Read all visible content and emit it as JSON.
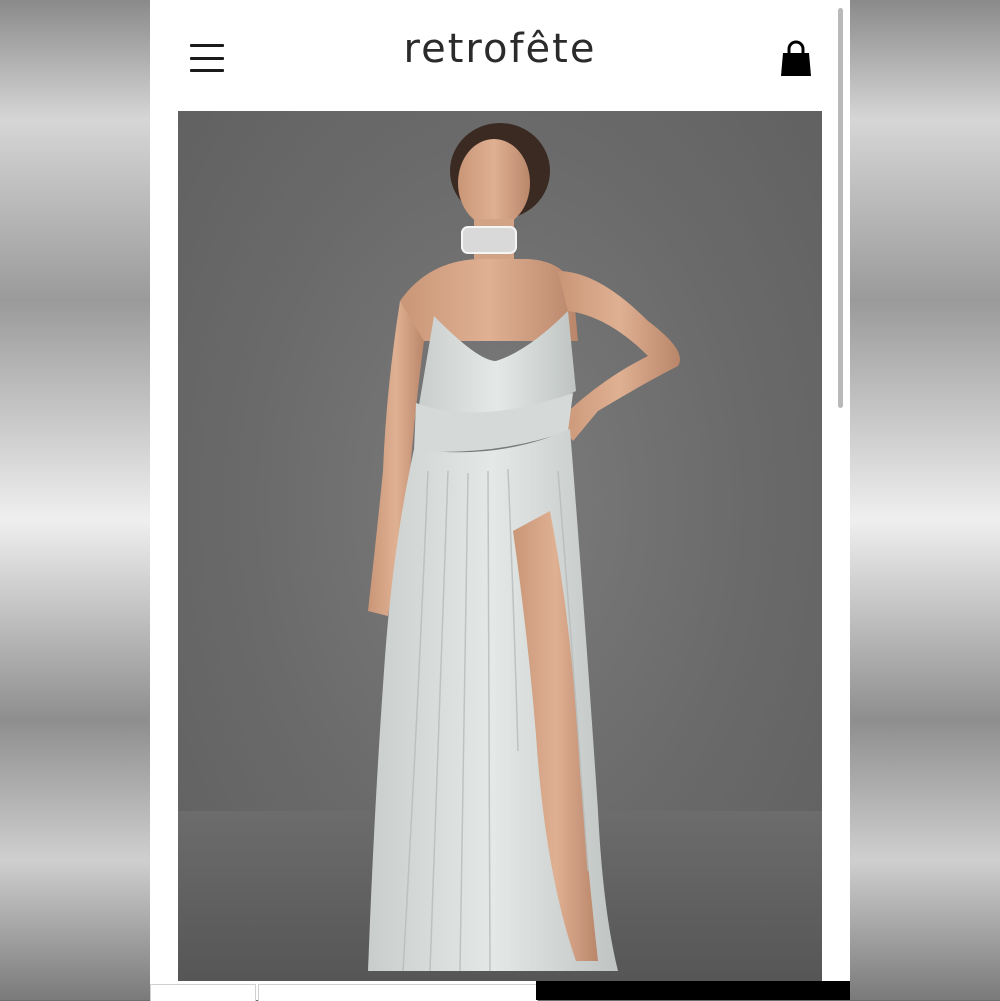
{
  "header": {
    "brand": "retrofête",
    "menu_icon": "hamburger-menu-icon",
    "cart_icon": "shopping-bag-icon"
  },
  "product_image": {
    "subject": "model-in-pleated-gown-icon"
  },
  "colors": {
    "page_bg": "#ffffff",
    "photo_bg": "#6e6e6e",
    "dress": "#dfe3e1",
    "brand_text": "#2b2b2b",
    "accent_bar": "#000000"
  }
}
